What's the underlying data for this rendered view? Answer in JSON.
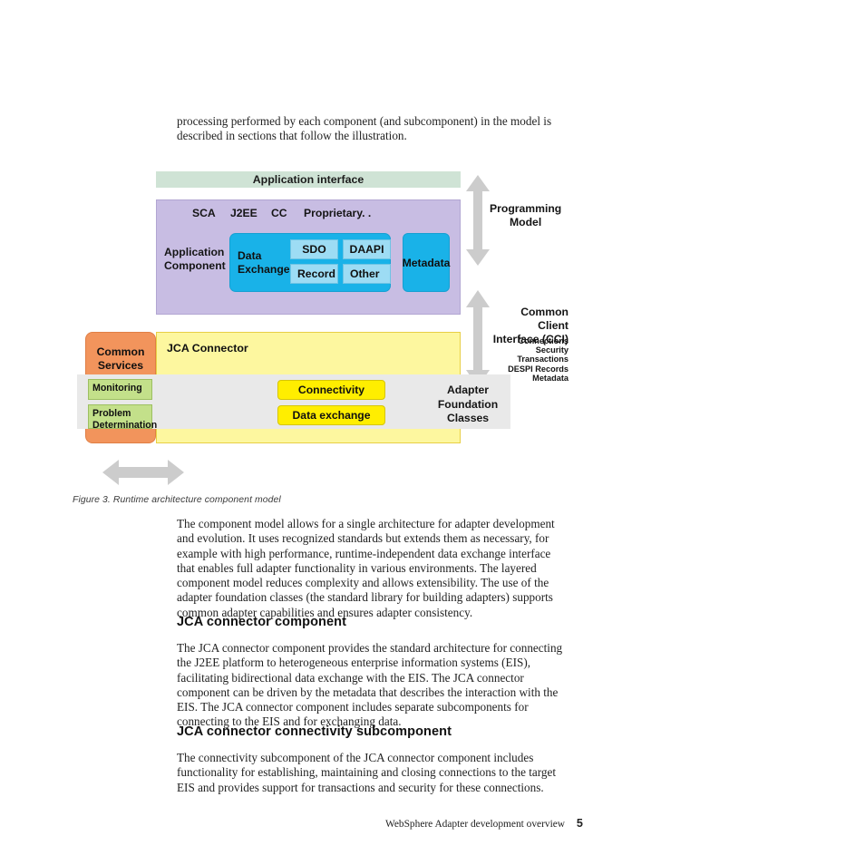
{
  "document": {
    "intro_paragraph": "processing performed by each component (and subcomponent) in the model is described in sections that follow the illustration.",
    "figure_caption": "Figure 3. Runtime architecture component model",
    "paragraph_after_figure": "The component model allows for a single architecture for adapter development and evolution. It uses recognized standards but extends them as necessary, for example with high performance, runtime-independent data exchange interface that enables full adapter functionality in various environments. The layered component model reduces complexity and allows extensibility. The use of the adapter foundation classes (the standard library for building adapters) supports common adapter capabilities and ensures adapter consistency.",
    "sections": [
      {
        "heading": "JCA connector component",
        "body": "The JCA connector component provides the standard architecture for connecting the J2EE platform to heterogeneous enterprise information systems (EIS), facilitating bidirectional data exchange with the EIS. The JCA connector component can be driven by the metadata that describes the interaction with the EIS. The JCA connector component includes separate subcomponents for connecting to the EIS and for exchanging data."
      },
      {
        "heading": "JCA connector connectivity subcomponent",
        "body": "The connectivity subcomponent of the JCA connector component includes functionality for establishing, maintaining and closing connections to the target EIS and provides support for transactions and security for these connections."
      }
    ],
    "footer": {
      "running_title": "WebSphere Adapter development overview",
      "page_number": "5"
    }
  },
  "figure": {
    "application_interface": "Application interface",
    "protocols": [
      "SCA",
      "J2EE",
      "CC",
      "Proprietary. ."
    ],
    "application_component": "Application\nComponent",
    "application_component_line1": "Application",
    "application_component_line2": "Component",
    "data_exchange_line1": "Data",
    "data_exchange_line2": "Exchange",
    "data_exchange_items": [
      "SDO",
      "DAAPI",
      "Record",
      "Other"
    ],
    "metadata": "Metadata",
    "common_services_line1": "Common",
    "common_services_line2": "Services",
    "jca_connector": "JCA Connector",
    "monitoring": "Monitoring",
    "problem_determination_line1": "Problem",
    "problem_determination_line2": "Determination",
    "connectivity": "Connectivity",
    "data_exchange_button": "Data exchange",
    "adapter_foundation_classes": [
      "Adapter",
      "Foundation",
      "Classes"
    ],
    "programming_model_line1": "Programming",
    "programming_model_line2": "Model",
    "cci_line1": "Common Client",
    "cci_line2": "Interface (CCI)",
    "cci_items": [
      "Connections",
      "Security",
      "Transactions",
      "DESPI Records",
      "Metadata"
    ],
    "colors": {
      "application_interface_bg": "#cfe3d5",
      "application_component_bg": "#c8bde3",
      "data_exchange_bg": "#19b2e8",
      "data_exchange_item_bg": "#9ddcf4",
      "common_services_bg": "#f2945c",
      "jca_connector_bg": "#fdf79f",
      "grey_band_bg": "#e9e9e9",
      "green_box_bg": "#c3e08a",
      "yellow_button_bg": "#ffee00",
      "arrow_gray": "#cccccc"
    }
  }
}
